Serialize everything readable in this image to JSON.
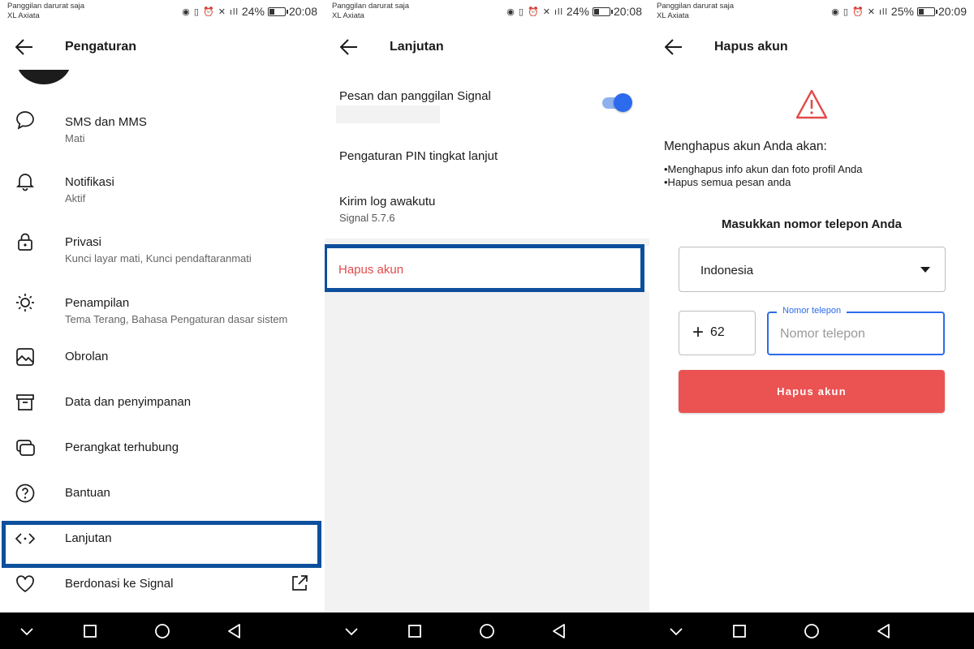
{
  "statusbar": {
    "carrier_line1": "Panggilan darurat saja",
    "carrier_line2": "XL Axiata",
    "screens": [
      {
        "battery": "24%",
        "time": "20:08"
      },
      {
        "battery": "24%",
        "time": "20:08"
      },
      {
        "battery": "25%",
        "time": "20:09"
      }
    ]
  },
  "screen1": {
    "title": "Pengaturan",
    "items": [
      {
        "title": "SMS dan MMS",
        "subtitle": "Mati",
        "icon": "chat-bubble-icon"
      },
      {
        "title": "Notifikasi",
        "subtitle": "Aktif",
        "icon": "bell-icon"
      },
      {
        "title": "Privasi",
        "subtitle": "Kunci layar mati, Kunci pendaftaranmati",
        "icon": "lock-icon"
      },
      {
        "title": "Penampilan",
        "subtitle": "Tema Terang, Bahasa Pengaturan dasar sistem",
        "icon": "sun-icon"
      },
      {
        "title": "Obrolan",
        "subtitle": "",
        "icon": "image-icon"
      },
      {
        "title": "Data dan penyimpanan",
        "subtitle": "",
        "icon": "archive-box-icon"
      },
      {
        "title": "Perangkat terhubung",
        "subtitle": "",
        "icon": "linked-devices-icon"
      },
      {
        "title": "Bantuan",
        "subtitle": "",
        "icon": "help-circle-icon"
      },
      {
        "title": "Lanjutan",
        "subtitle": "",
        "icon": "code-icon"
      },
      {
        "title": "Berdonasi ke Signal",
        "subtitle": "",
        "icon": "heart-icon"
      }
    ]
  },
  "screen2": {
    "title": "Lanjutan",
    "signal_messages": {
      "title": "Pesan dan panggilan Signal",
      "enabled": true
    },
    "pin_settings": {
      "title": "Pengaturan PIN tingkat lanjut"
    },
    "debug_log": {
      "title": "Kirim log awakutu",
      "subtitle": "Signal 5.7.6"
    },
    "delete_account": {
      "label": "Hapus akun"
    }
  },
  "screen3": {
    "title": "Hapus akun",
    "heading": "Menghapus akun Anda akan:",
    "bullets": [
      "•Menghapus info akun dan foto profil Anda",
      "•Hapus semua pesan anda"
    ],
    "phone_prompt": "Masukkan nomor telepon Anda",
    "country": "Indonesia",
    "country_code_plus": "+",
    "country_code": "62",
    "phone_label": "Nomor telepon",
    "phone_placeholder": "Nomor telepon",
    "phone_value": "",
    "delete_button": "Hapus akun"
  },
  "colors": {
    "accent": "#2c6bed",
    "danger": "#eb5353",
    "highlight": "#0d4f9c"
  }
}
